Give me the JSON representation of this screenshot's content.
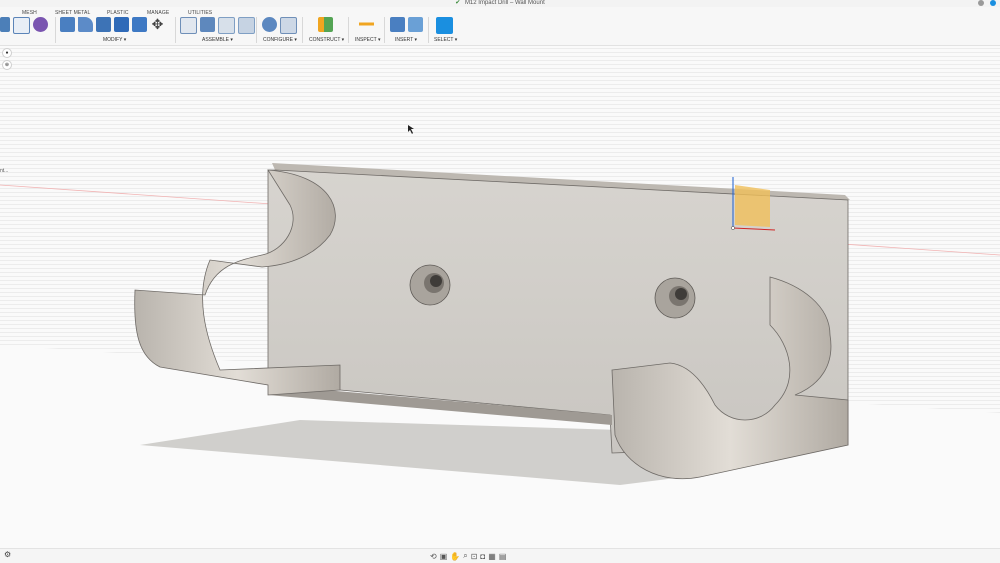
{
  "app": {
    "document_title": "M12 Impact Drill – Wall Mount",
    "check_mark": "✔"
  },
  "toolbar": {
    "tabs": [
      "MESH",
      "SHEET METAL",
      "PLASTIC",
      "MANAGE",
      "UTILITIES"
    ],
    "groups": [
      "MODIFY ▾",
      "ASSEMBLE ▾",
      "CONFIGURE ▾",
      "CONSTRUCT ▾",
      "INSPECT ▾",
      "INSERT ▾",
      "SELECT ▾"
    ],
    "icons": {
      "modify": [
        "press-pull-icon",
        "fillet-icon",
        "chamfer-icon",
        "shell-icon",
        "combine-icon",
        "move-icon"
      ],
      "assemble": [
        "new-component-icon",
        "joint-icon",
        "as-built-joint-icon",
        "rigid-group-icon"
      ],
      "configure": [
        "configure-table-icon",
        "configure-theme-icon"
      ],
      "construct": [
        "offset-plane-icon"
      ],
      "inspect": [
        "measure-icon"
      ],
      "insert": [
        "insert-derive-icon",
        "insert-canvas-icon"
      ],
      "select": [
        "select-cursor-icon"
      ]
    }
  },
  "viewport": {
    "left_truncated_label": "nt...",
    "model_color": "#cfcbc5",
    "model_shadow_color": "#bdbbb8",
    "plane_color": "#e9d28a"
  },
  "bottombar": {
    "settings_label": "⚙",
    "nav_icons": [
      "orbit-icon",
      "look-at-icon",
      "pan-icon",
      "zoom-icon",
      "fit-icon",
      "display-settings-icon",
      "grid-settings-icon",
      "viewports-icon"
    ]
  },
  "colors": {
    "accent_blue": "#1a8fe0",
    "toolbar_bg": "#f7f7f7",
    "grid_line": "#dcdcdc"
  }
}
